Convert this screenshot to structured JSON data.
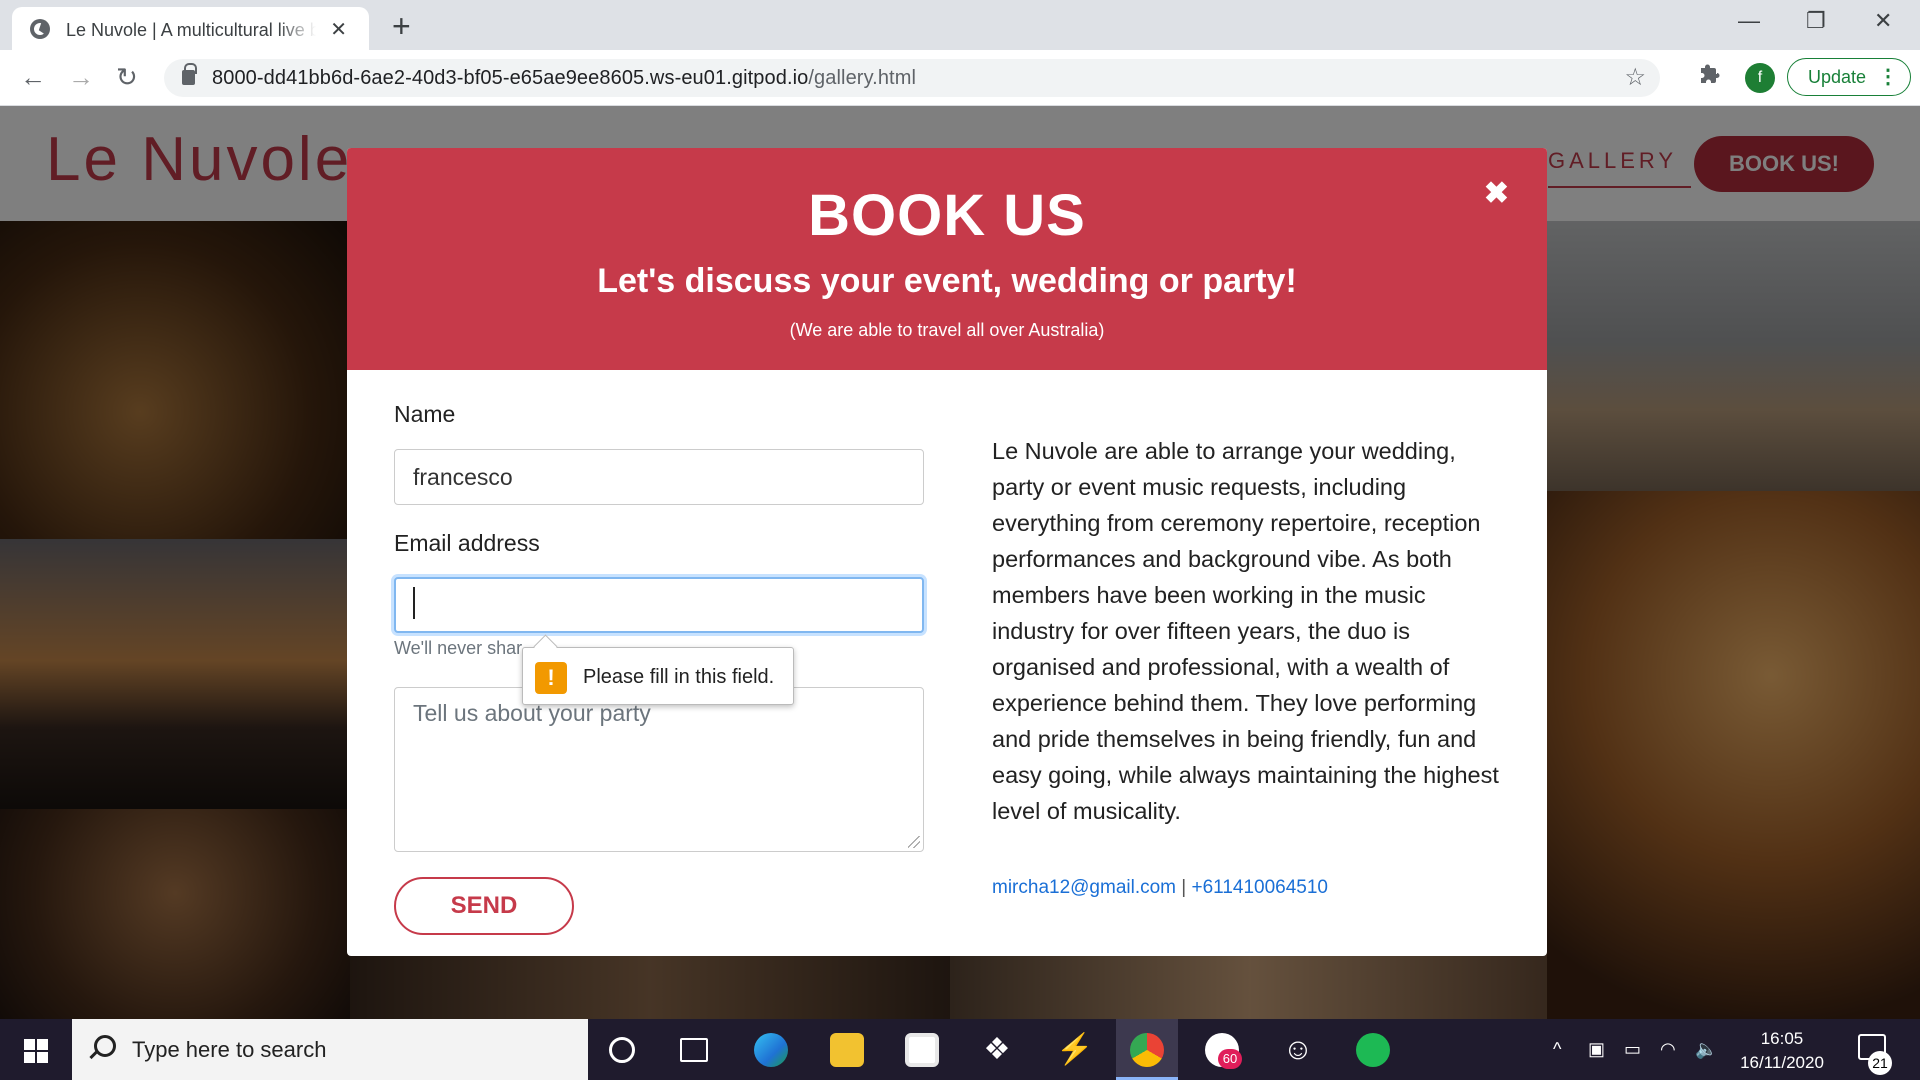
{
  "browser": {
    "tab_title": "Le Nuvole | A multicultural live band",
    "url_host": "8000-dd41bb6d-6ae2-40d3-bf05-e65ae9ee8605.ws-eu01.gitpod.io",
    "url_path": "/gallery.html",
    "profile_initial": "f",
    "update_label": "Update"
  },
  "site": {
    "logo": "Le Nuvole",
    "nav_gallery": "GALLERY",
    "book_button": "BOOK US!"
  },
  "modal": {
    "title": "BOOK US",
    "subtitle": "Let's discuss your event, wedding or party!",
    "note": "(We are able to travel all over Australia)",
    "close_glyph": "✖",
    "form": {
      "name_label": "Name",
      "name_value": "francesco",
      "email_label": "Email address",
      "email_value": "",
      "help_text": "We'll never shar",
      "message_placeholder": "Tell us about your party",
      "send_label": "SEND"
    },
    "validation": {
      "icon": "!",
      "message": "Please fill in this field."
    },
    "about": "Le Nuvole are able to arrange your wedding, party or event music requests, including everything from ceremony repertoire, reception performances and background vibe. As both members have been working in the music industry for over fifteen years, the duo is organised and professional, with a wealth of experience behind them. They love performing and pride themselves in being friendly, fun and easy going, while always maintaining the highest level of musicality.",
    "contact_email": "mircha12@gmail.com",
    "contact_sep": " | ",
    "contact_phone": "+611410064510"
  },
  "taskbar": {
    "search_placeholder": "Type here to search",
    "time": "16:05",
    "date": "16/11/2020",
    "notifications": "21",
    "slack_badge": "60"
  }
}
